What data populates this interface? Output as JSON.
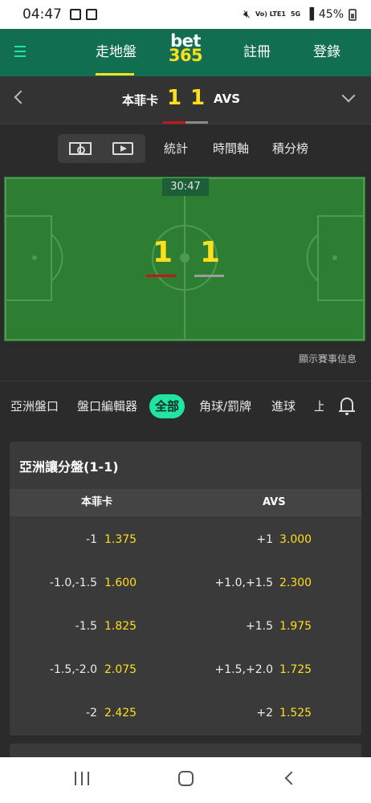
{
  "status_bar": {
    "time": "04:47",
    "network": "Vo) LTE1",
    "net_5g": "5G",
    "battery": "45%"
  },
  "top_nav": {
    "live_label": "走地盤",
    "logo_line1": "bet",
    "logo_line2": "365",
    "register_label": "註冊",
    "login_label": "登錄",
    "accent_color": "#126e51",
    "highlight_color": "#ffdf1b"
  },
  "match": {
    "home_team": "本菲卡",
    "away_team": "AVS",
    "home_score": "1",
    "away_score": "1"
  },
  "view_tabs": {
    "pitch_icon": "pitch-icon",
    "video_icon": "video-icon",
    "stats_label": "統計",
    "timeline_label": "時間軸",
    "standings_label": "積分榜"
  },
  "pitch": {
    "clock": "30:47",
    "home_score": "1",
    "away_score": "1",
    "show_info_label": "顯示賽事信息"
  },
  "category_tabs": {
    "items": [
      "亞洲盤口",
      "盤口編輯器",
      "全部",
      "角球/罰牌",
      "進球",
      "上"
    ],
    "active": "全部"
  },
  "market": {
    "title": "亞洲讓分盤(1-1)",
    "col_home": "本菲卡",
    "col_away": "AVS",
    "rows": [
      {
        "home_line": "-1",
        "home_odds": "1.375",
        "away_line": "+1",
        "away_odds": "3.000"
      },
      {
        "home_line": "-1.0,-1.5",
        "home_odds": "1.600",
        "away_line": "+1.0,+1.5",
        "away_odds": "2.300"
      },
      {
        "home_line": "-1.5",
        "home_odds": "1.825",
        "away_line": "+1.5",
        "away_odds": "1.975"
      },
      {
        "home_line": "-1.5,-2.0",
        "home_odds": "2.075",
        "away_line": "+1.5,+2.0",
        "away_odds": "1.725"
      },
      {
        "home_line": "-2",
        "home_odds": "2.425",
        "away_line": "+2",
        "away_odds": "1.525"
      }
    ]
  }
}
